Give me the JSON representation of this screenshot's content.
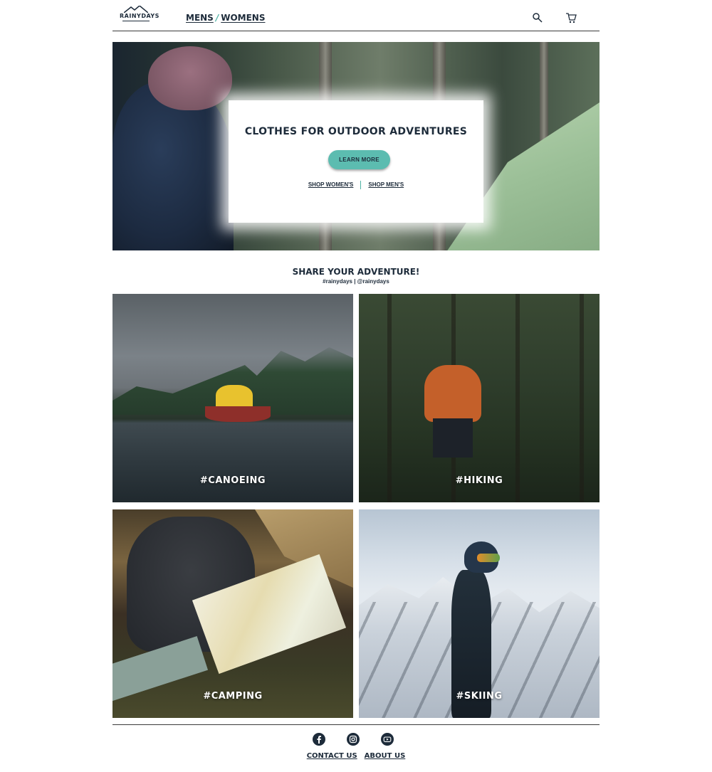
{
  "header": {
    "logo_text": "RAINYDAYS",
    "nav": {
      "mens": "MENS",
      "slash": "/",
      "womens": "WOMENS"
    },
    "icons": [
      "search-icon",
      "cart-icon"
    ]
  },
  "hero": {
    "title": "CLOTHES FOR OUTDOOR ADVENTURES",
    "button": "LEARN MORE",
    "shop_womens": "SHOP WOMEN'S",
    "shop_mens": "SHOP MEN'S"
  },
  "share": {
    "title": "SHARE YOUR ADVENTURE!",
    "subtitle": "#rainydays | @rainydays"
  },
  "tiles": [
    {
      "label": "#CANOEING"
    },
    {
      "label": "#HIKING"
    },
    {
      "label": "#CAMPING"
    },
    {
      "label": "#SKIING"
    }
  ],
  "footer": {
    "social_icons": [
      "facebook-icon",
      "instagram-icon",
      "youtube-icon"
    ],
    "contact": "CONTACT US",
    "about": "ABOUT US"
  },
  "colors": {
    "accent": "#5cbcb0",
    "text": "#1d2b3a"
  }
}
